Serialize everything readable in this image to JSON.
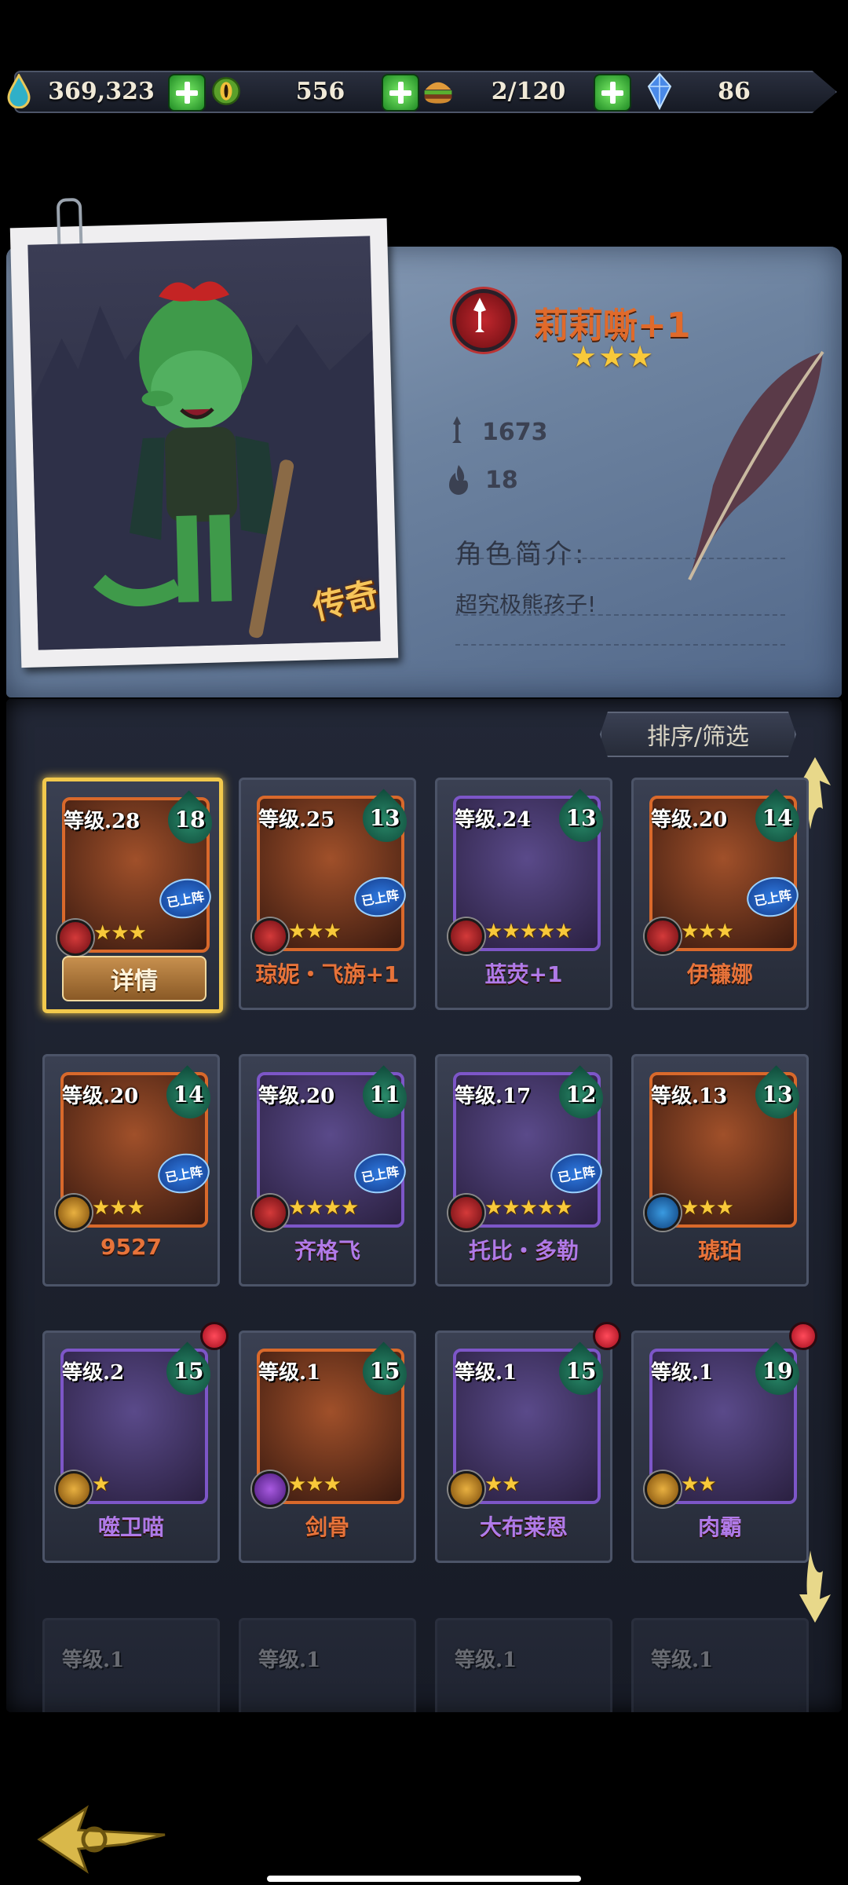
{
  "resources": {
    "water": "369,323",
    "eye_coin": "556",
    "food": "2/120",
    "crystal": "86"
  },
  "hero": {
    "name": "莉莉嘶+1",
    "stars": "★★★",
    "rarity_tag": "传奇",
    "attack": "1673",
    "power": "18",
    "intro_label": "角色简介:",
    "intro_text": "超究极熊孩子!"
  },
  "sort_button": "排序/筛选",
  "detail_button": "详情",
  "deployed_label": "已上阵",
  "roster": [
    {
      "level": "等级.28",
      "leaf": "18",
      "stars": "★★★",
      "name": "",
      "cls": "red",
      "selected": true,
      "deployed": true,
      "frame": "orange"
    },
    {
      "level": "等级.25",
      "leaf": "13",
      "stars": "★★★",
      "name": "琼妮・飞旃+1",
      "cls": "red",
      "deployed": true,
      "frame": "orange"
    },
    {
      "level": "等级.24",
      "leaf": "13",
      "stars": "★★★★★",
      "name": "蓝荧+1",
      "cls": "red",
      "deployed": false,
      "frame": "purple"
    },
    {
      "level": "等级.20",
      "leaf": "14",
      "stars": "★★★",
      "name": "伊镰娜",
      "cls": "red",
      "deployed": true,
      "frame": "orange"
    },
    {
      "level": "等级.20",
      "leaf": "14",
      "stars": "★★★",
      "name": "9527",
      "cls": "gold",
      "deployed": true,
      "frame": "orange"
    },
    {
      "level": "等级.20",
      "leaf": "11",
      "stars": "★★★★",
      "name": "齐格飞",
      "cls": "red",
      "deployed": true,
      "frame": "purple"
    },
    {
      "level": "等级.17",
      "leaf": "12",
      "stars": "★★★★★",
      "name": "托比・多勒",
      "cls": "red",
      "deployed": true,
      "frame": "purple"
    },
    {
      "level": "等级.13",
      "leaf": "13",
      "stars": "★★★",
      "name": "琥珀",
      "cls": "blue",
      "deployed": false,
      "frame": "orange"
    },
    {
      "level": "等级.2",
      "leaf": "15",
      "stars": "★",
      "name": "噬卫喵",
      "cls": "gold",
      "deployed": false,
      "frame": "purple",
      "dot": true
    },
    {
      "level": "等级.1",
      "leaf": "15",
      "stars": "★★★",
      "name": "剑骨",
      "cls": "violet",
      "deployed": false,
      "frame": "orange",
      "dot": false
    },
    {
      "level": "等级.1",
      "leaf": "15",
      "stars": "★★",
      "name": "大布莱恩",
      "cls": "gold",
      "deployed": false,
      "frame": "purple",
      "dot": true
    },
    {
      "level": "等级.1",
      "leaf": "19",
      "stars": "★★",
      "name": "肉霸",
      "cls": "gold",
      "deployed": false,
      "frame": "purple",
      "dot": true
    }
  ],
  "partial_row_level": "等级.1",
  "colors": {
    "accent_gold": "#f2c94c",
    "name_orange": "#e7733a",
    "name_purple": "#b07ae8",
    "star": "#f8c93a"
  }
}
